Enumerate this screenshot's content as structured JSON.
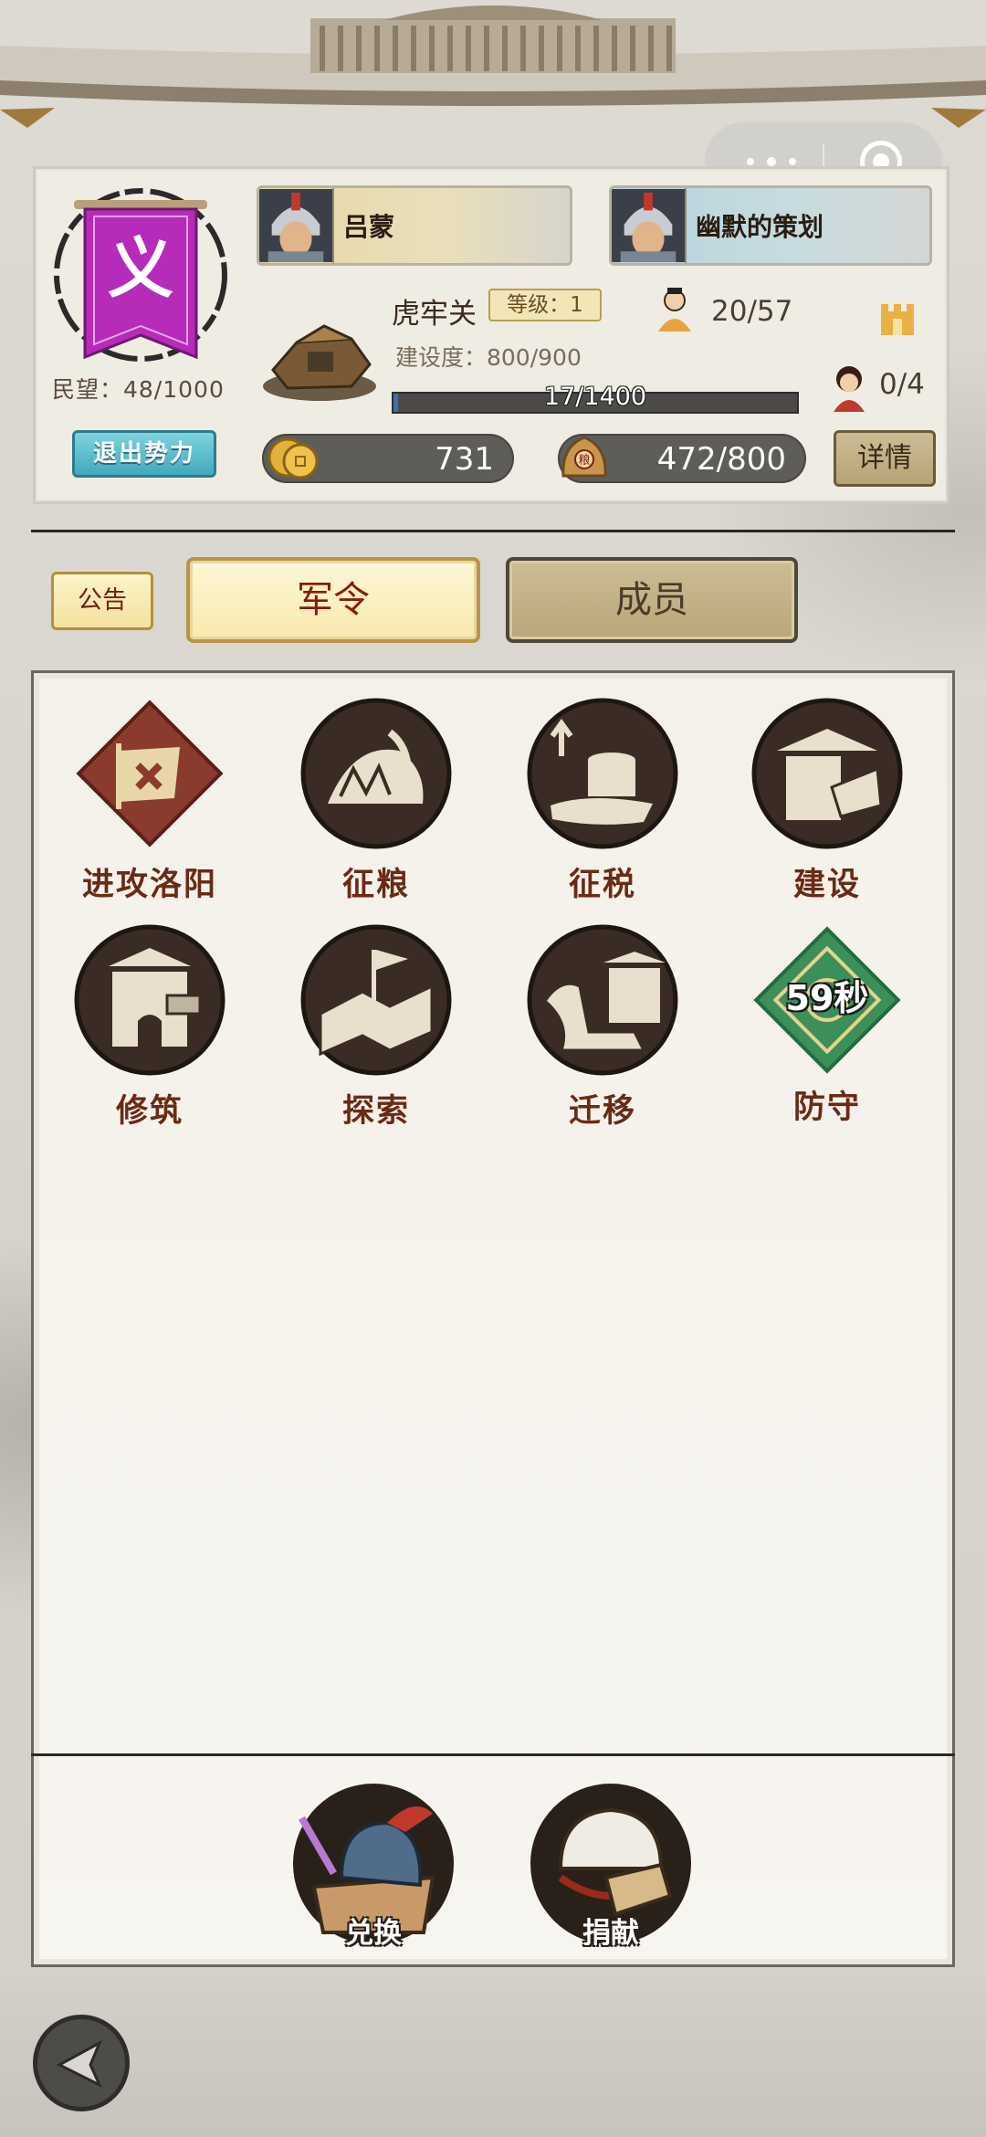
{
  "faction": {
    "banner_char": "义",
    "popularity": "民望：48/1000",
    "exit_label": "退出势力"
  },
  "generals": [
    {
      "name": "吕蒙"
    },
    {
      "name": "幽默的策划"
    }
  ],
  "city": {
    "name": "虎牢关",
    "level": "等级：1",
    "build_label": "建设度：800/900",
    "progress_text": "17/1400",
    "progress_fraction": 0.012,
    "population": "20/57",
    "heroes": "0/4"
  },
  "resources": {
    "coins": "731",
    "grain": "472/800",
    "grain_icon_char": "粮"
  },
  "detail_label": "详情",
  "tabs": {
    "notice": "公告",
    "orders": "军令",
    "members": "成员"
  },
  "commands": [
    {
      "label": "进攻洛阳",
      "icon": "attack-flag-icon"
    },
    {
      "label": "征粮",
      "icon": "grain-collect-icon"
    },
    {
      "label": "征税",
      "icon": "tax-collect-icon"
    },
    {
      "label": "建设",
      "icon": "construct-icon"
    },
    {
      "label": "修筑",
      "icon": "fortify-icon"
    },
    {
      "label": "探索",
      "icon": "explore-map-icon"
    },
    {
      "label": "迁移",
      "icon": "migrate-horse-icon"
    },
    {
      "label": "防守",
      "icon": "defend-icon",
      "timer": "59秒"
    }
  ],
  "bottom_actions": {
    "exchange": "兑换",
    "donate": "捐献"
  },
  "colors": {
    "accent_red": "#8a1a10",
    "exit_button": "#43a9bd",
    "banner_purple": "#b62bb8",
    "defend_green": "#3a8f5a"
  }
}
